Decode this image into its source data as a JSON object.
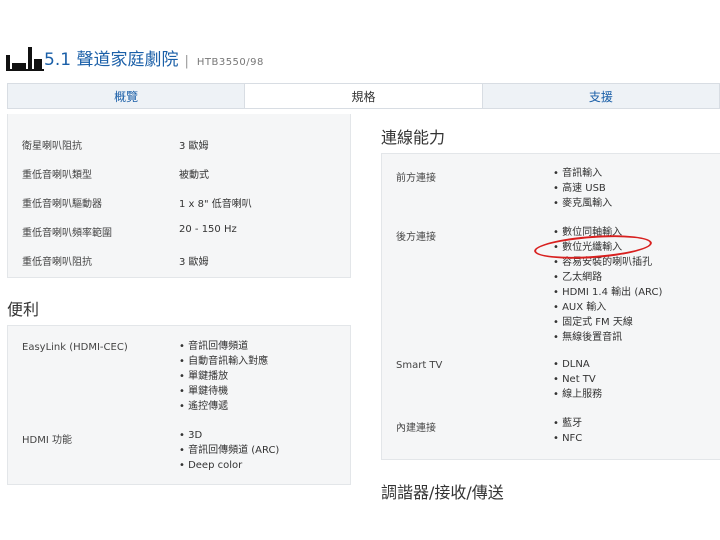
{
  "header": {
    "title": "5.1 聲道家庭劇院",
    "separator": "|",
    "model": "HTB3550/98",
    "logo_icon": "speaker-set-icon"
  },
  "tabs": [
    {
      "label": "概覽",
      "active": false
    },
    {
      "label": "規格",
      "active": true
    },
    {
      "label": "支援",
      "active": false
    }
  ],
  "speaker_specs": [
    {
      "label": "衛星喇叭阻抗",
      "value": "3 歐姆"
    },
    {
      "label": "重低音喇叭類型",
      "value": "被動式"
    },
    {
      "label": "重低音喇叭驅動器",
      "value": "1 x 8\" 低音喇叭"
    },
    {
      "label": "重低音喇叭頻率範圍",
      "value": "20 - 150 Hz"
    },
    {
      "label": "重低音喇叭阻抗",
      "value": "3 歐姆"
    }
  ],
  "convenience": {
    "heading": "便利",
    "rows": [
      {
        "label": "EasyLink (HDMI-CEC)",
        "items": [
          "音訊回傳頻道",
          "自動音訊輸入對應",
          "單鍵播放",
          "單鍵待機",
          "遙控傳遞"
        ]
      },
      {
        "label": "HDMI 功能",
        "items": [
          "3D",
          "音訊回傳頻道 (ARC)",
          "Deep color"
        ]
      }
    ]
  },
  "connectivity": {
    "heading": "連線能力",
    "rows": [
      {
        "label": "前方連接",
        "items": [
          "音訊輸入",
          "高速 USB",
          "麥克風輸入"
        ]
      },
      {
        "label": "後方連接",
        "items": [
          "數位同軸輸入",
          "數位光纖輸入",
          "容易安裝的喇叭插孔",
          "乙太網路",
          "HDMI 1.4 輸出 (ARC)",
          "AUX 輸入",
          "固定式 FM 天線",
          "無線後置音訊"
        ]
      },
      {
        "label": "Smart TV",
        "items": [
          "DLNA",
          "Net TV",
          "線上服務"
        ]
      },
      {
        "label": "內建連接",
        "items": [
          "藍牙",
          "NFC"
        ]
      }
    ]
  },
  "next_section_heading": "調諧器/接收/傳送",
  "annotation": {
    "circled_item": "數位光纖輸入",
    "color": "#d8201f"
  }
}
